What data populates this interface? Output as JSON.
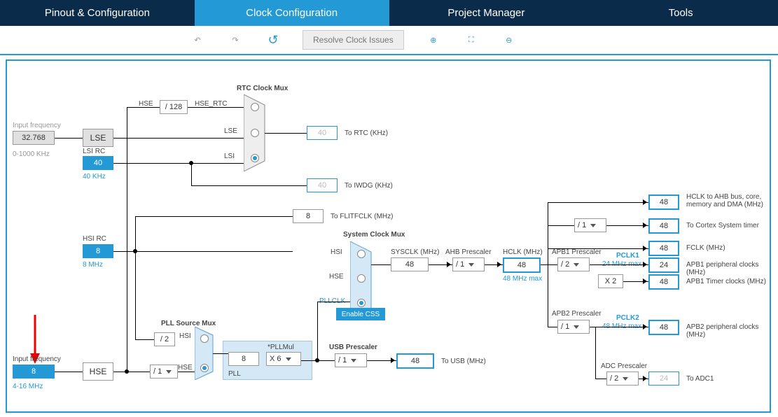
{
  "tabs": {
    "pinout": "Pinout & Configuration",
    "clock": "Clock Configuration",
    "project": "Project Manager",
    "tools": "Tools"
  },
  "toolbar": {
    "resolve": "Resolve Clock Issues"
  },
  "labels": {
    "input_freq": "Input frequency",
    "range_lse": "0-1000 KHz",
    "lse": "LSE",
    "lsi_rc": "LSI RC",
    "lsi_freq": "40 KHz",
    "hsi_rc": "HSI RC",
    "hsi_freq": "8 MHz",
    "hse": "HSE",
    "hse_range": "4-16 MHz",
    "rtc_mux": "RTC Clock Mux",
    "hse_sig": "HSE",
    "hse_rtc": "HSE_RTC",
    "lse_sig": "LSE",
    "lsi_sig": "LSI",
    "to_rtc": "To RTC (KHz)",
    "to_iwdg": "To IWDG (KHz)",
    "to_flitfclk": "To FLITFCLK (MHz)",
    "sysclk_mux": "System Clock Mux",
    "hsi": "HSI",
    "pllclk": "PLLCLK",
    "enable_css": "Enable CSS",
    "sysclk": "SYSCLK (MHz)",
    "ahb_pre": "AHB Prescaler",
    "hclk": "HCLK (MHz)",
    "hclk_max": "48 MHz max",
    "apb1_pre": "APB1 Prescaler",
    "apb2_pre": "APB2 Prescaler",
    "pclk1": "PCLK1",
    "pclk1_max": "24 MHz max",
    "pclk2": "PCLK2",
    "pclk2_max": "48 MHz max",
    "hclk_ahb": "HCLK to AHB bus, core, memory and DMA (MHz)",
    "cortex": "To Cortex System timer",
    "fclk": "FCLK (MHz)",
    "apb1_per": "APB1 peripheral clocks (MHz)",
    "apb1_tim": "APB1 Timer clocks (MHz)",
    "apb2_per": "APB2 peripheral clocks (MHz)",
    "adc_pre": "ADC Prescaler",
    "to_adc1": "To ADC1",
    "pll_src_mux": "PLL Source Mux",
    "pllmul": "*PLLMul",
    "pll": "PLL",
    "usb_pre": "USB Prescaler",
    "to_usb": "To USB (MHz)",
    "x2": "X 2"
  },
  "values": {
    "lse_khz": "32.768",
    "lsi": "40",
    "hsi": "8",
    "hse_in": "8",
    "div128": "/ 128",
    "rtc_out": "40",
    "iwdg_out": "40",
    "flitfclk": "8",
    "sysclk": "48",
    "hclk": "48",
    "hclk_ahb": "48",
    "cortex": "48",
    "fclk": "48",
    "apb1_per": "24",
    "apb1_tim": "48",
    "apb2_per": "48",
    "adc_out": "24",
    "pll_div2": "/ 2",
    "pll_in": "8",
    "pllmul": "X 6",
    "usb_out": "48",
    "ahb_sel": "/ 1",
    "cortex_sel": "/ 1",
    "apb1_sel": "/ 2",
    "apb2_sel": "/ 1",
    "adc_sel": "/ 2",
    "hse_div": "/ 1",
    "usb_sel": "/ 1"
  }
}
